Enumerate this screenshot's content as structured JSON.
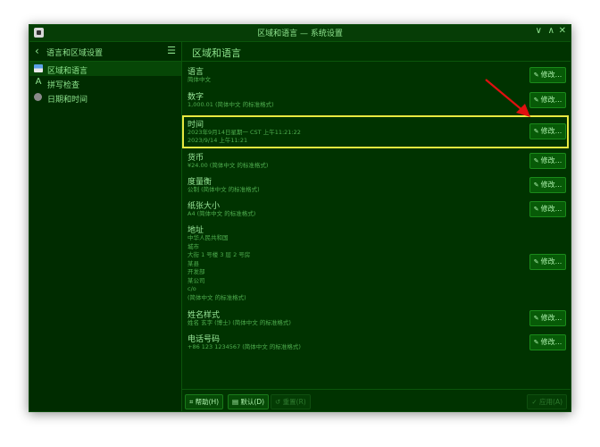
{
  "window": {
    "title": "区域和语言 — 系统设置",
    "controls": [
      "∨",
      "∧",
      "✕"
    ]
  },
  "sidebar": {
    "back_icon": "chevron-left-icon",
    "title": "语言和区域设置",
    "menu_icon": "hamburger-icon",
    "items": [
      {
        "label": "区域和语言",
        "icon": "flag-icon",
        "active": true
      },
      {
        "label": "拼写检查",
        "icon": "spellcheck-icon",
        "active": false
      },
      {
        "label": "日期和时间",
        "icon": "clock-icon",
        "active": false
      }
    ]
  },
  "main": {
    "title": "区域和语言",
    "modify_label": "修改...",
    "rows": [
      {
        "label": "语言",
        "subs": [
          "简体中文"
        ]
      },
      {
        "label": "数字",
        "subs": [
          "1,000.01 (简体中文 的标准格式)"
        ]
      },
      {
        "label": "时间",
        "subs": [
          "2023年9月14日星期一 CST 上午11:21:22",
          "2023/9/14 上午11:21"
        ]
      },
      {
        "label": "货币",
        "subs": [
          "¥24.00 (简体中文 的标准格式)"
        ]
      },
      {
        "label": "度量衡",
        "subs": [
          "公制 (简体中文 的标准格式)"
        ]
      },
      {
        "label": "纸张大小",
        "subs": [
          "A4 (简体中文 的标准格式)"
        ]
      },
      {
        "label": "地址",
        "subs": [
          "中华人民共和国",
          "城市",
          "大街 1 号楼 3 层 2 号房",
          "某县",
          "开发部",
          "某公司",
          "c/o",
          "(简体中文 的标准格式)"
        ]
      },
      {
        "label": "姓名样式",
        "subs": [
          "姓名 玄字 (博士) (简体中文 的标准格式)"
        ]
      },
      {
        "label": "电话号码",
        "subs": [
          "+86 123 1234567 (简体中文 的标准格式)"
        ]
      }
    ]
  },
  "footer": {
    "help": "帮助(H)",
    "defaults": "默认(D)",
    "reset": "重置(R)",
    "apply": "应用(A)"
  },
  "colors": {
    "highlight": "#e8e840",
    "arrow": "#e01010"
  }
}
